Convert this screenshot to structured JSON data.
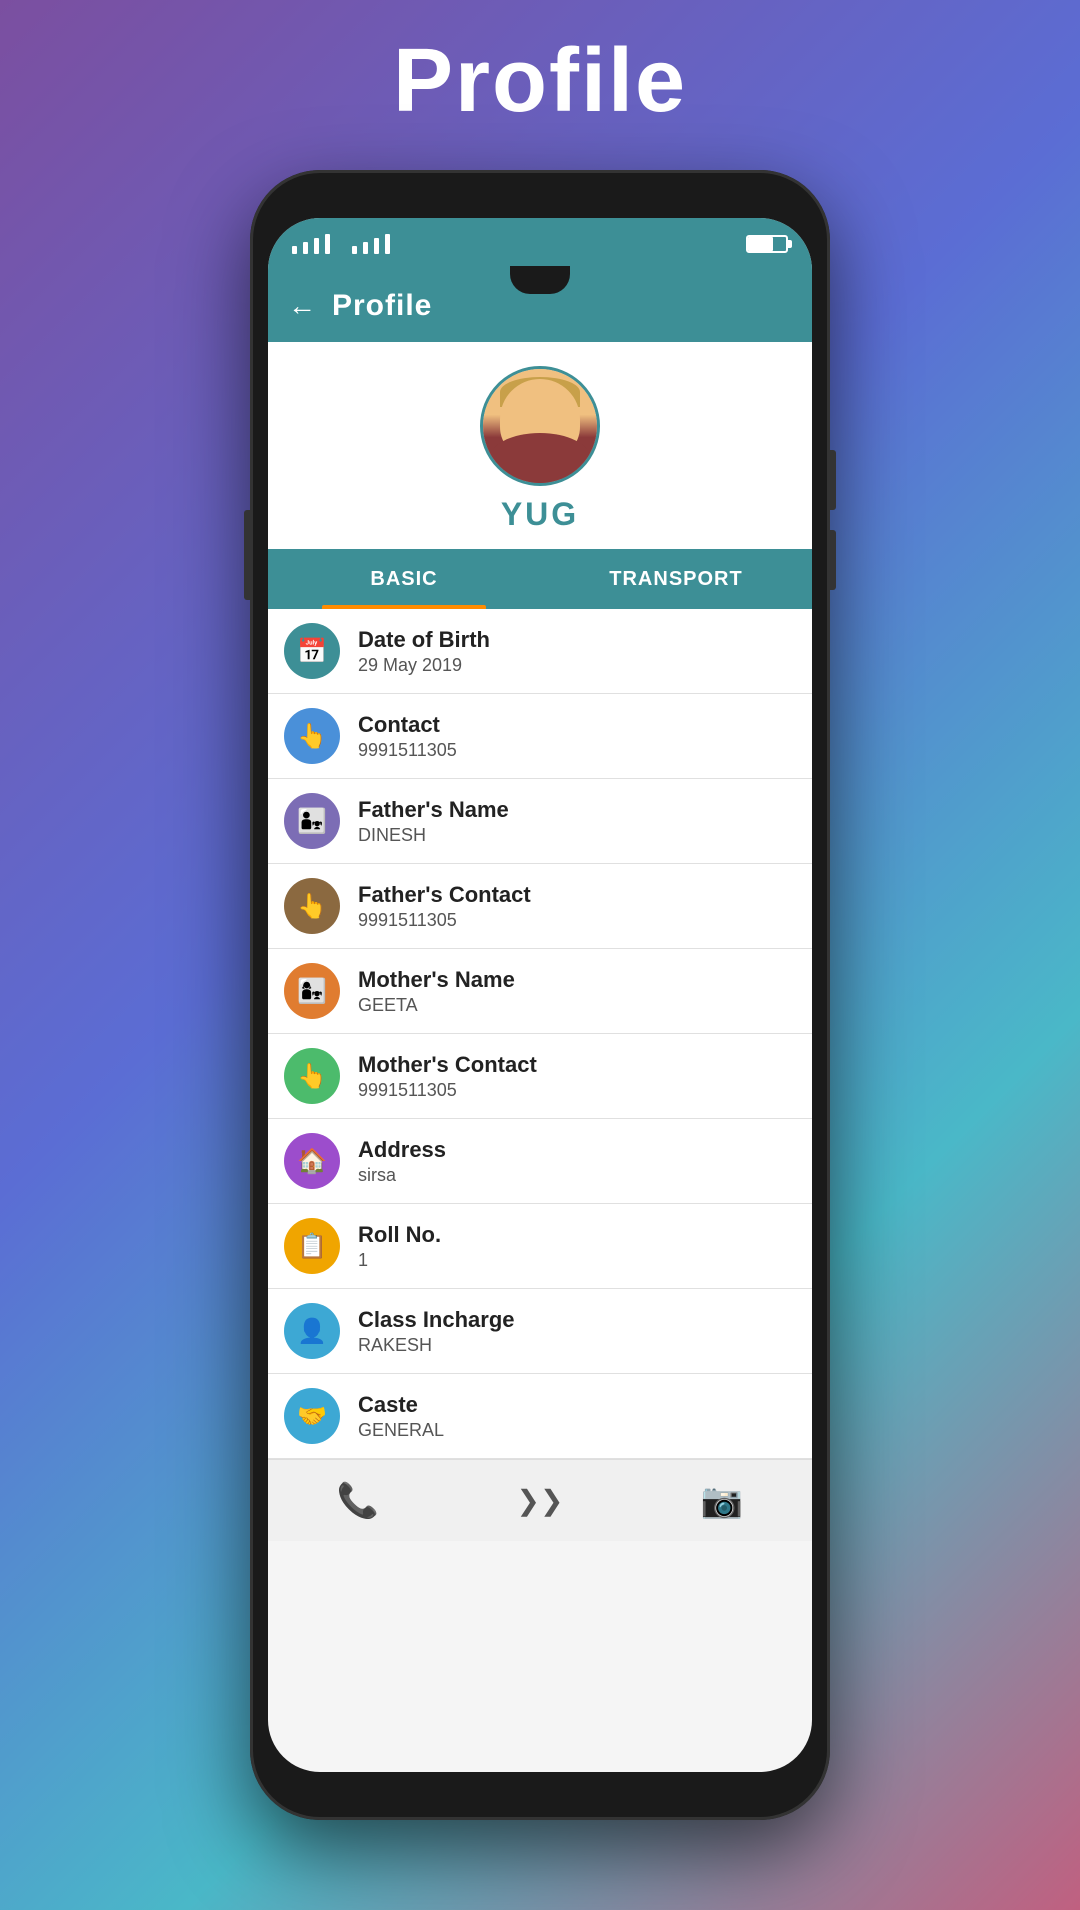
{
  "pageTitle": "Profile",
  "header": {
    "title": "Profile",
    "backLabel": "←"
  },
  "student": {
    "name": "YUG"
  },
  "tabs": [
    {
      "id": "basic",
      "label": "BASIC",
      "active": true
    },
    {
      "id": "transport",
      "label": "TRANSPORT",
      "active": false
    }
  ],
  "fields": [
    {
      "id": "dob",
      "label": "Date of Birth",
      "value": "29 May 2019",
      "iconColor": "#3d8f96",
      "iconSymbol": "📅"
    },
    {
      "id": "contact",
      "label": "Contact",
      "value": "9991511305",
      "iconColor": "#4a90d9",
      "iconSymbol": "👆"
    },
    {
      "id": "fatherName",
      "label": "Father's Name",
      "value": "DINESH",
      "iconColor": "#7c6db5",
      "iconSymbol": "👨‍👧"
    },
    {
      "id": "fatherContact",
      "label": "Father's Contact",
      "value": "9991511305",
      "iconColor": "#8b6940",
      "iconSymbol": "👆"
    },
    {
      "id": "motherName",
      "label": "Mother's Name",
      "value": "GEETA",
      "iconColor": "#e07c30",
      "iconSymbol": "👩‍👧"
    },
    {
      "id": "motherContact",
      "label": "Mother's Contact",
      "value": "9991511305",
      "iconColor": "#4cbb6c",
      "iconSymbol": "👆"
    },
    {
      "id": "address",
      "label": "Address",
      "value": "sirsa",
      "iconColor": "#9c4dcc",
      "iconSymbol": "🏠"
    },
    {
      "id": "rollNo",
      "label": "Roll No.",
      "value": "1",
      "iconColor": "#f0a500",
      "iconSymbol": "📋"
    },
    {
      "id": "classIncharge",
      "label": "Class Incharge",
      "value": "RAKESH",
      "iconColor": "#3da8d4",
      "iconSymbol": "👤"
    },
    {
      "id": "caste",
      "label": "Caste",
      "value": "GENERAL",
      "iconColor": "#3da8d4",
      "iconSymbol": "🤝"
    }
  ],
  "bottomNav": {
    "phone": "📞",
    "home": "⋀⋀",
    "camera": "📷"
  }
}
